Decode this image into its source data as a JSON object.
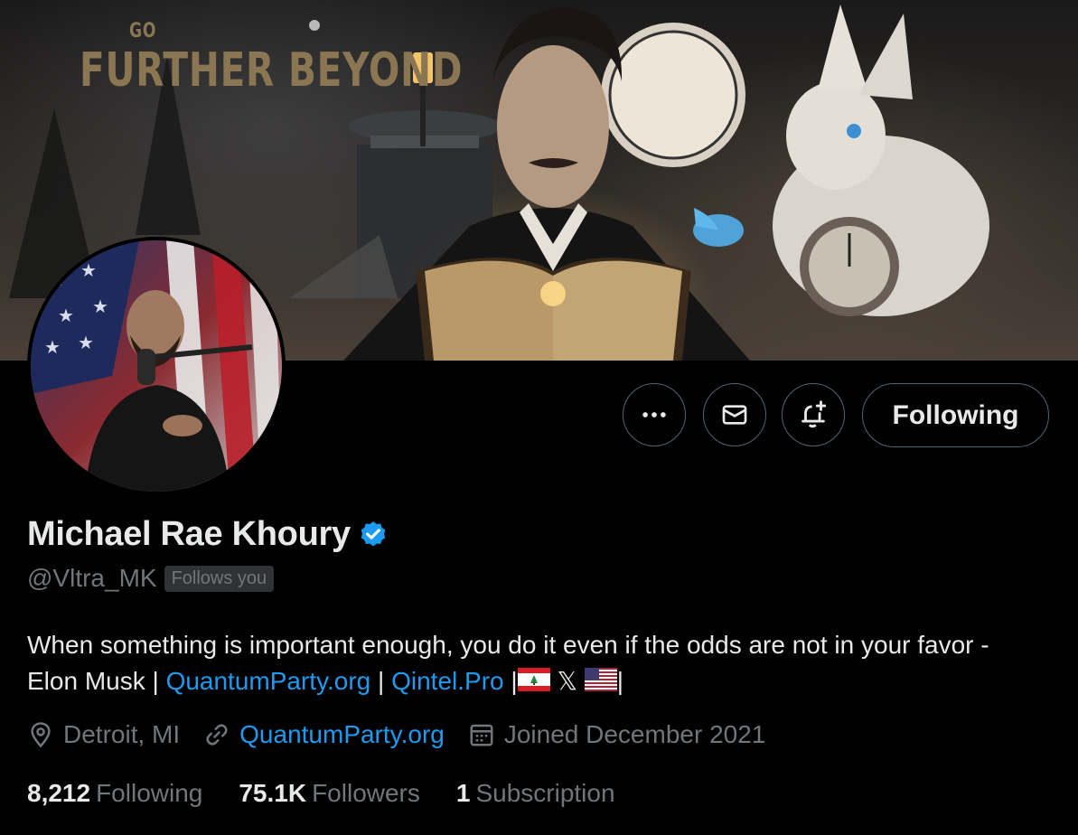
{
  "banner": {
    "line1": "GO",
    "line2": "FURTHER BEYOND"
  },
  "actions": {
    "more_icon": "more-horizontal-icon",
    "message_icon": "envelope-icon",
    "notify_icon": "bell-plus-icon",
    "following_label": "Following"
  },
  "profile": {
    "name": "Michael Rae Khoury",
    "verified_icon": "verified-badge-icon",
    "verified_color": "#1d9bf0",
    "handle": "@Vltra_MK",
    "follows_you": "Follows you",
    "bio": {
      "text1": "When something is important enough, you do it even if the odds are not in your favor - Elon Musk | ",
      "link1": "QuantumParty.org",
      "sep1": " | ",
      "link2": "Qintel.Pro",
      "sep2": " |",
      "x_glyph": "𝕏",
      "end": "|"
    },
    "location": "Detroit, MI",
    "website": "QuantumParty.org",
    "joined": "Joined December 2021"
  },
  "stats": {
    "following_count": "8,212",
    "following_label": "Following",
    "followers_count": "75.1K",
    "followers_label": "Followers",
    "subscription_count": "1",
    "subscription_label": "Subscription"
  },
  "colors": {
    "accent": "#1d9bf0",
    "muted": "#71767b",
    "border": "#536471",
    "text": "#e7e9ea",
    "background": "#000000"
  }
}
